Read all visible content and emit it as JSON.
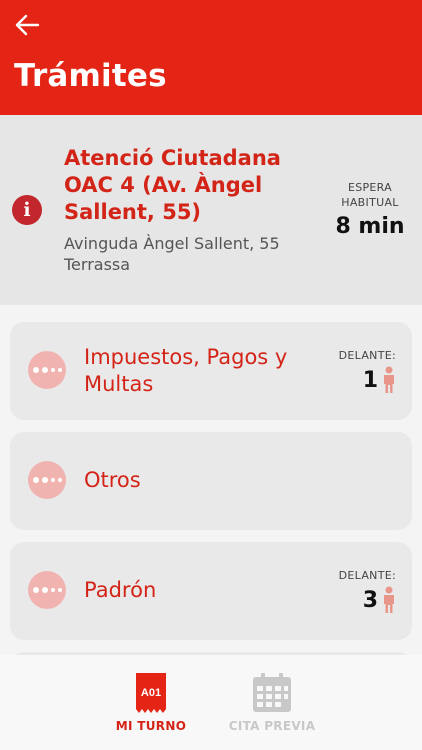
{
  "header": {
    "title": "Trámites",
    "back_icon": "arrow-left-icon"
  },
  "office": {
    "name": "Atenció Ciutadana OAC 4 (Av. Àngel Sallent, 55)",
    "address": "Avinguda Àngel Sallent, 55 Terrassa",
    "wait_label": "ESPERA HABITUAL",
    "wait_value": "8 min",
    "info_icon": "info-icon",
    "info_glyph": "i"
  },
  "services": [
    {
      "label": "Impuestos, Pagos y Multas",
      "ahead_label": "DELANTE:",
      "ahead_count": "1"
    },
    {
      "label": "Otros"
    },
    {
      "label": "Padrón",
      "ahead_label": "DELANTE:",
      "ahead_count": "3"
    }
  ],
  "tabs": [
    {
      "label": "MI TURNO",
      "icon": "ticket-icon",
      "icon_text": "A01",
      "active": true
    },
    {
      "label": "CITA PREVIA",
      "icon": "calendar-icon",
      "active": false
    }
  ],
  "colors": {
    "brand_red": "#e42415",
    "text_red": "#d42418",
    "icon_pink": "#f1b3b0",
    "person_icon": "#e8958a",
    "inactive_tab": "#c8c8c8"
  }
}
